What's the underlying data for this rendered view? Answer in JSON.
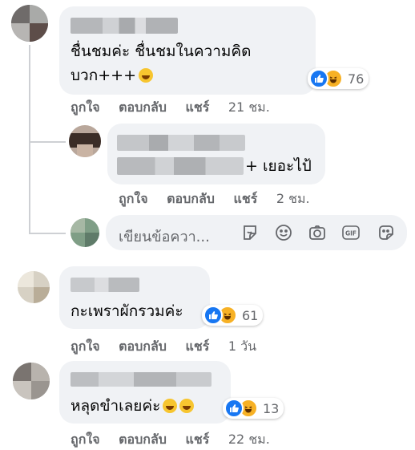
{
  "actions": {
    "like": "ถูกใจ",
    "reply": "ตอบกลับ",
    "share": "แชร์"
  },
  "comments": [
    {
      "text_line1": "ชื่นชมค่ะ ชื่นชมในความคิด",
      "text_line2": "บวก+++",
      "reaction_count": "76",
      "time": "21 ชม."
    },
    {
      "text_suffix": "+ เยอะไป้",
      "time": "2 ชม."
    },
    {
      "text": "กะเพราผักรวมค่ะ",
      "reaction_count": "61",
      "time": "1 วัน"
    },
    {
      "text": "หลุดขำเลยค่ะ",
      "reaction_count": "13",
      "time": "22 ชม."
    }
  ],
  "composer": {
    "placeholder": "เขียนข้อควา..."
  },
  "colors": {
    "bubble": "#f0f2f5",
    "like_blue": "#1877f2",
    "haha_yellow": "#f7b125",
    "secondary_text": "#65676b"
  },
  "icons": [
    "like-icon",
    "haha-icon",
    "sticker-icon",
    "emoji-icon",
    "camera-icon",
    "gif-icon",
    "avatar-sticker-icon"
  ]
}
